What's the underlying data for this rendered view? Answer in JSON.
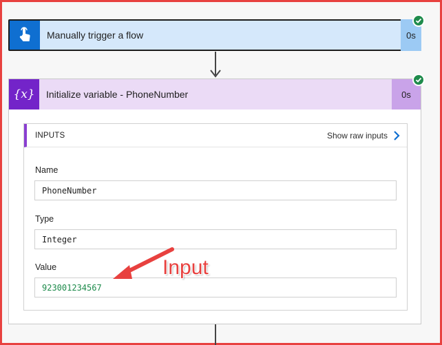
{
  "trigger_card": {
    "title": "Manually trigger a flow",
    "duration": "0s",
    "icon": "touch-hand-icon",
    "status_icon": "success-check-icon"
  },
  "variable_card": {
    "title": "Initialize variable - PhoneNumber",
    "duration": "0s",
    "icon": "variable-braces-icon",
    "icon_glyph": "{x}",
    "status_icon": "success-check-icon",
    "inputs": {
      "header": "INPUTS",
      "show_raw": "Show raw inputs",
      "fields": [
        {
          "label": "Name",
          "value": "PhoneNumber"
        },
        {
          "label": "Type",
          "value": "Integer"
        },
        {
          "label": "Value",
          "value": "923001234567"
        }
      ]
    }
  },
  "annotation": {
    "text": "Input"
  },
  "colors": {
    "frame_border": "#e8413f",
    "trigger_accent": "#0f6fd1",
    "variable_accent": "#7324c9",
    "success": "#1f8b4c",
    "value_text": "#1c8a4a"
  }
}
